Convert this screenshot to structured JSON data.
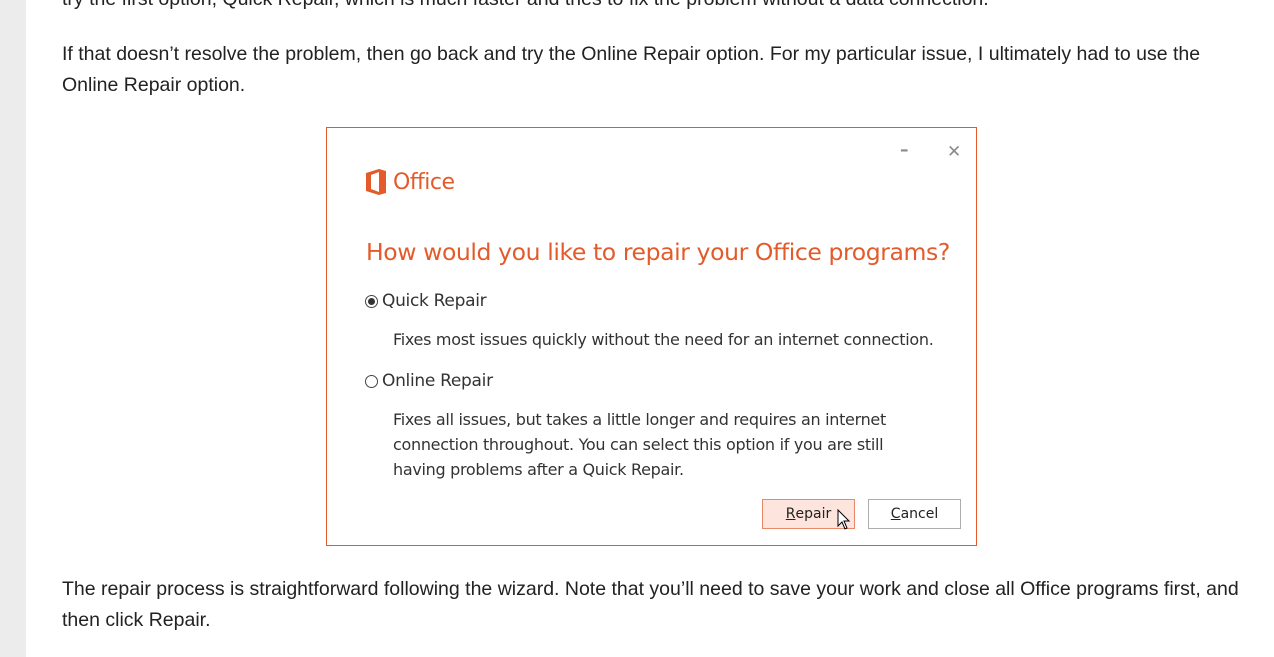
{
  "article": {
    "top_fragment": "try the first option, Quick Repair, which is much faster and tries to fix the problem without a data connection.",
    "para1": "If that doesn’t resolve the problem, then go back and try the Online Repair option. For my particular issue, I ultimately had to use the Online Repair option.",
    "para2": "The repair process is straightforward following the wizard. Note that you’ll need to save your work and close all Office programs first, and then click Repair."
  },
  "dialog": {
    "minimize_glyph": "–",
    "close_glyph": "✕",
    "logo_text": "Office",
    "heading": "How would you like to repair your Office programs?",
    "options": [
      {
        "label": "Quick Repair",
        "selected": true,
        "description": "Fixes most issues quickly without the need for an internet connection."
      },
      {
        "label": "Online Repair",
        "selected": false,
        "description": "Fixes all issues, but takes a little longer and requires an internet connection throughout. You can select this option if you are still having problems after a Quick Repair."
      }
    ],
    "repair_button": {
      "mnemonic": "R",
      "rest": "epair"
    },
    "cancel_button": {
      "mnemonic": "C",
      "rest": "ancel"
    },
    "accent_color": "#e35b2a"
  }
}
